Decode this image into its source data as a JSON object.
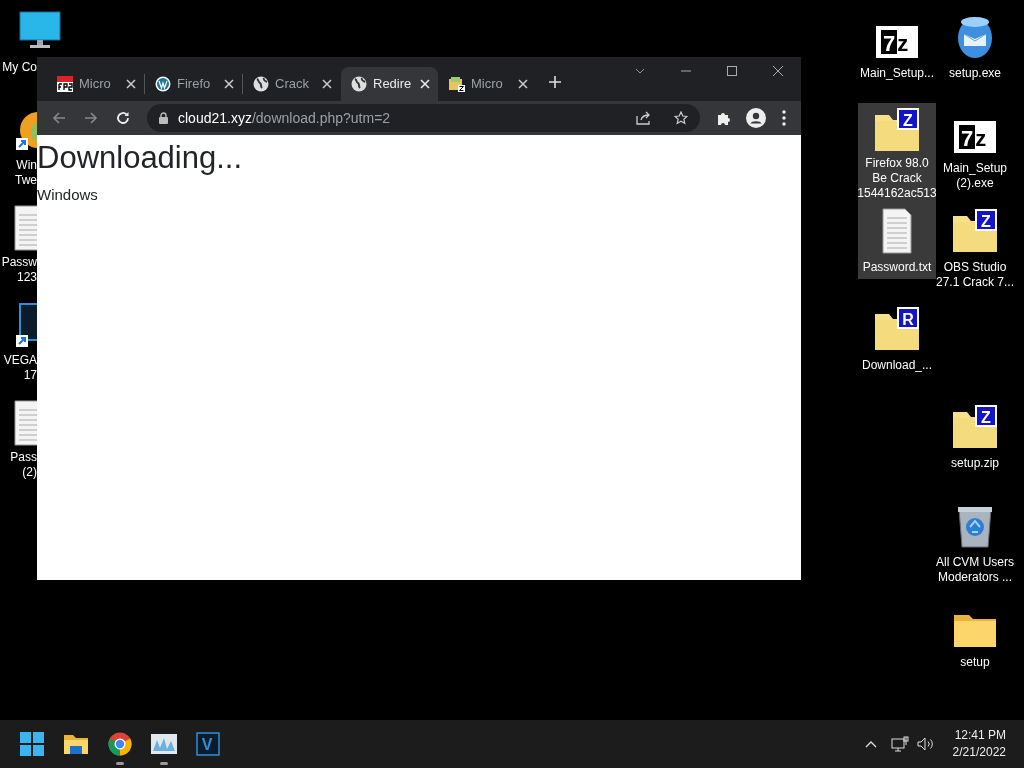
{
  "desktop": {
    "left_icons": [
      {
        "kind": "monitor",
        "lines": [
          "My Co"
        ]
      },
      {
        "kind": "shortcut-app",
        "lines": [
          "Win",
          "Twe"
        ]
      },
      {
        "kind": "text-file",
        "lines": [
          "Passw",
          "123"
        ]
      },
      {
        "kind": "vegas",
        "lines": [
          "VEGA",
          "17"
        ]
      },
      {
        "kind": "text-file",
        "lines": [
          "Pass",
          "(2)"
        ]
      }
    ],
    "right_icons": [
      {
        "kind": "seven-zip",
        "badge": "7z",
        "lines": [
          "Main_Setup..."
        ],
        "selected": false
      },
      {
        "kind": "installer",
        "lines": [
          "setup.exe"
        ],
        "selected": false
      },
      {
        "kind": "archive",
        "badge": "Z",
        "lines": [
          "Firefox 98.0",
          "Be Crack",
          "1544162ac513"
        ],
        "selected": true
      },
      {
        "kind": "seven-zip",
        "badge": "7z",
        "lines": [
          "Main_Setup",
          "(2).exe"
        ],
        "selected": false
      },
      {
        "kind": "text-file",
        "lines": [
          "Password.txt"
        ],
        "selected": true
      },
      {
        "kind": "archive",
        "badge": "Z",
        "lines": [
          "OBS Studio",
          "27.1 Crack 7..."
        ],
        "selected": false
      },
      {
        "kind": "archive",
        "badge": "R",
        "lines": [
          "Download_..."
        ],
        "selected": false
      },
      {
        "kind": "archive",
        "badge": "Z",
        "lines": [
          "setup.zip"
        ],
        "selected": false
      },
      {
        "kind": "recycle-bin",
        "lines": [
          "All CVM Users",
          "Moderators ..."
        ],
        "selected": false
      },
      {
        "kind": "folder",
        "lines": [
          "setup"
        ],
        "selected": false
      }
    ]
  },
  "browser": {
    "tabs": [
      {
        "label": "Micro",
        "kind": "fps",
        "selected": false
      },
      {
        "label": "Firefo",
        "kind": "wordpress",
        "selected": false
      },
      {
        "label": "Crack",
        "kind": "globe",
        "selected": false
      },
      {
        "label": "Redire",
        "kind": "globe",
        "selected": true
      },
      {
        "label": "Micro",
        "kind": "archive",
        "selected": false
      }
    ],
    "address": {
      "host": "cloud21.xyz",
      "path": "/download.php?utm=2"
    },
    "page": {
      "heading": "Downloading...",
      "text": "Windows"
    }
  },
  "taskbar": {
    "apps": [
      {
        "kind": "start",
        "running": false
      },
      {
        "kind": "explorer",
        "running": false
      },
      {
        "kind": "chrome",
        "running": true
      },
      {
        "kind": "monitor-app",
        "running": true
      },
      {
        "kind": "vegas",
        "running": false,
        "badge": "V"
      }
    ],
    "time": "12:41 PM",
    "date": "2/21/2022"
  }
}
